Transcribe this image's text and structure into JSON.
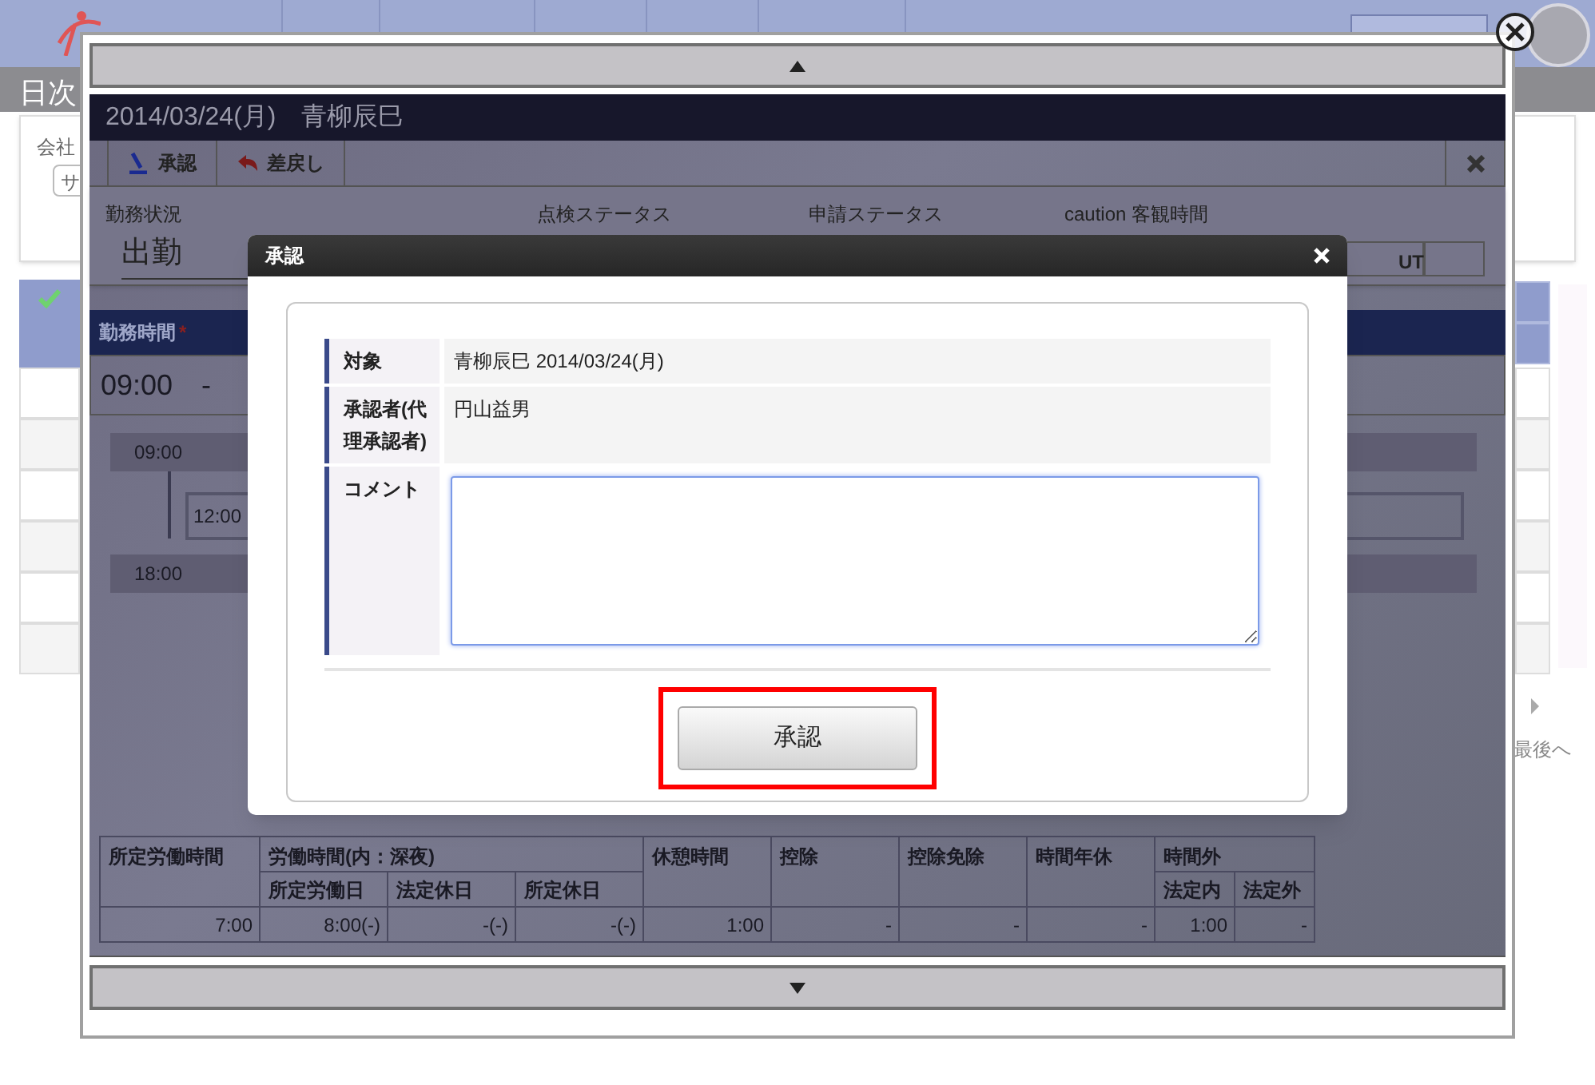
{
  "background_page": {
    "page_title": "日次",
    "company_label": "会社",
    "company_field_value": "サ",
    "pager_last": "最後へ"
  },
  "record_viewer": {
    "title": "2014/03/24(月)　青柳辰巳",
    "toolbar": [
      {
        "label": "承認",
        "kind": "approve"
      },
      {
        "label": "差戻し",
        "kind": "return"
      }
    ],
    "status_labels": [
      "勤務状況",
      "点検ステータス",
      "申請ステータス",
      "caution 客観時間"
    ],
    "work_status": "出勤",
    "cut_field_text": "UT",
    "work_time": {
      "label": "勤務時間",
      "required_mark": "*",
      "range": "09:00　-",
      "timeline": [
        "09:00",
        "12:00",
        "18:00"
      ]
    },
    "summary": {
      "groups": [
        {
          "label": "所定労働時間"
        },
        {
          "label": "労働時間(内：深夜)",
          "sub": [
            "所定労働日",
            "法定休日",
            "所定休日"
          ]
        },
        {
          "label": "休憩時間"
        },
        {
          "label": "控除"
        },
        {
          "label": "控除免除"
        },
        {
          "label": "時間年休"
        },
        {
          "label": "時間外",
          "sub": [
            "法定内",
            "法定外"
          ]
        }
      ],
      "values": [
        "7:00",
        "8:00(-)",
        "-(-)",
        "-(-)",
        "1:00",
        "-",
        "-",
        "-",
        "1:00",
        "-"
      ]
    }
  },
  "dialog": {
    "title": "承認",
    "fields": [
      {
        "label": "対象",
        "kind": "text",
        "value": "青柳辰巳 2014/03/24(月)"
      },
      {
        "label": "承認者(代理承認者)",
        "kind": "text",
        "value": "円山益男"
      },
      {
        "label": "コメント",
        "kind": "textarea"
      }
    ],
    "button": {
      "label": "承認",
      "highlighted": true
    }
  }
}
